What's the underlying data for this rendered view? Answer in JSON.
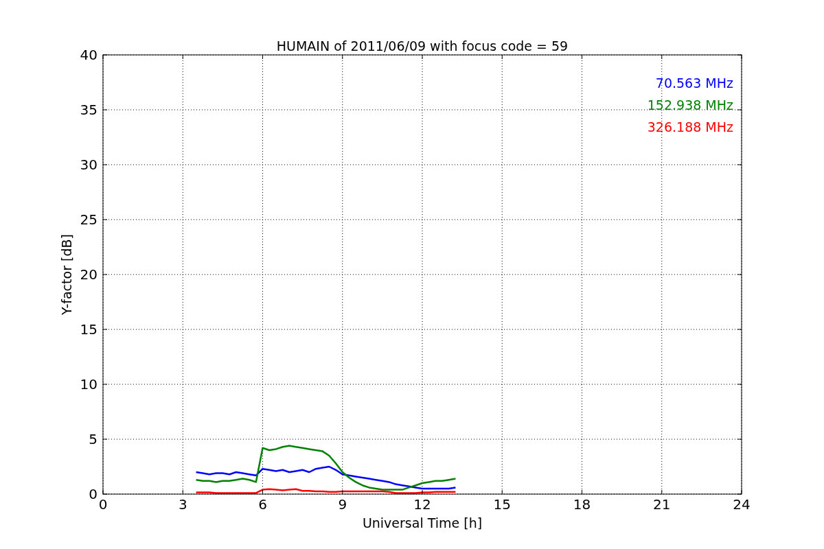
{
  "chart_data": {
    "type": "line",
    "grid": true,
    "title": "HUMAIN of 2011/06/09 with focus code = 59",
    "xlabel": "Universal Time [h]",
    "ylabel": "Y-factor [dB]",
    "xlim": [
      0,
      24
    ],
    "ylim": [
      0,
      40
    ],
    "xticks": [
      0,
      3,
      6,
      9,
      12,
      15,
      18,
      21,
      24
    ],
    "yticks": [
      0,
      5,
      10,
      15,
      20,
      25,
      30,
      35,
      40
    ],
    "x": [
      3.5,
      3.75,
      4,
      4.25,
      4.5,
      4.75,
      5,
      5.25,
      5.5,
      5.75,
      6,
      6.25,
      6.5,
      6.75,
      7,
      7.25,
      7.5,
      7.75,
      8,
      8.25,
      8.5,
      8.75,
      9,
      9.25,
      9.5,
      9.75,
      10,
      10.25,
      10.5,
      10.75,
      11,
      11.25,
      11.5,
      11.75,
      12,
      12.25,
      12.5,
      12.75,
      13,
      13.25
    ],
    "series": [
      {
        "name": "70.563 MHz",
        "color": "#0000ff",
        "values": [
          2.0,
          1.9,
          1.8,
          1.9,
          1.9,
          1.8,
          2.0,
          1.9,
          1.8,
          1.7,
          2.3,
          2.2,
          2.1,
          2.2,
          2.0,
          2.1,
          2.2,
          2.0,
          2.3,
          2.4,
          2.5,
          2.2,
          1.8,
          1.7,
          1.6,
          1.5,
          1.4,
          1.3,
          1.2,
          1.1,
          0.9,
          0.8,
          0.7,
          0.6,
          0.5,
          0.5,
          0.5,
          0.5,
          0.5,
          0.6
        ]
      },
      {
        "name": "152.938 MHz",
        "color": "#008000",
        "values": [
          1.3,
          1.2,
          1.2,
          1.1,
          1.2,
          1.2,
          1.3,
          1.4,
          1.3,
          1.1,
          4.2,
          4.0,
          4.1,
          4.3,
          4.4,
          4.3,
          4.2,
          4.1,
          4.0,
          3.9,
          3.5,
          2.8,
          2.0,
          1.5,
          1.1,
          0.8,
          0.6,
          0.5,
          0.4,
          0.4,
          0.4,
          0.4,
          0.6,
          0.8,
          1.0,
          1.1,
          1.2,
          1.2,
          1.3,
          1.4
        ]
      },
      {
        "name": "326.188 MHz",
        "color": "#ff0000",
        "values": [
          0.15,
          0.15,
          0.15,
          0.1,
          0.1,
          0.1,
          0.1,
          0.1,
          0.1,
          0.1,
          0.4,
          0.45,
          0.4,
          0.35,
          0.4,
          0.45,
          0.3,
          0.3,
          0.25,
          0.25,
          0.2,
          0.2,
          0.25,
          0.25,
          0.25,
          0.25,
          0.25,
          0.25,
          0.25,
          0.2,
          0.1,
          0.1,
          0.1,
          0.1,
          0.15,
          0.15,
          0.2,
          0.2,
          0.2,
          0.2
        ]
      }
    ]
  }
}
